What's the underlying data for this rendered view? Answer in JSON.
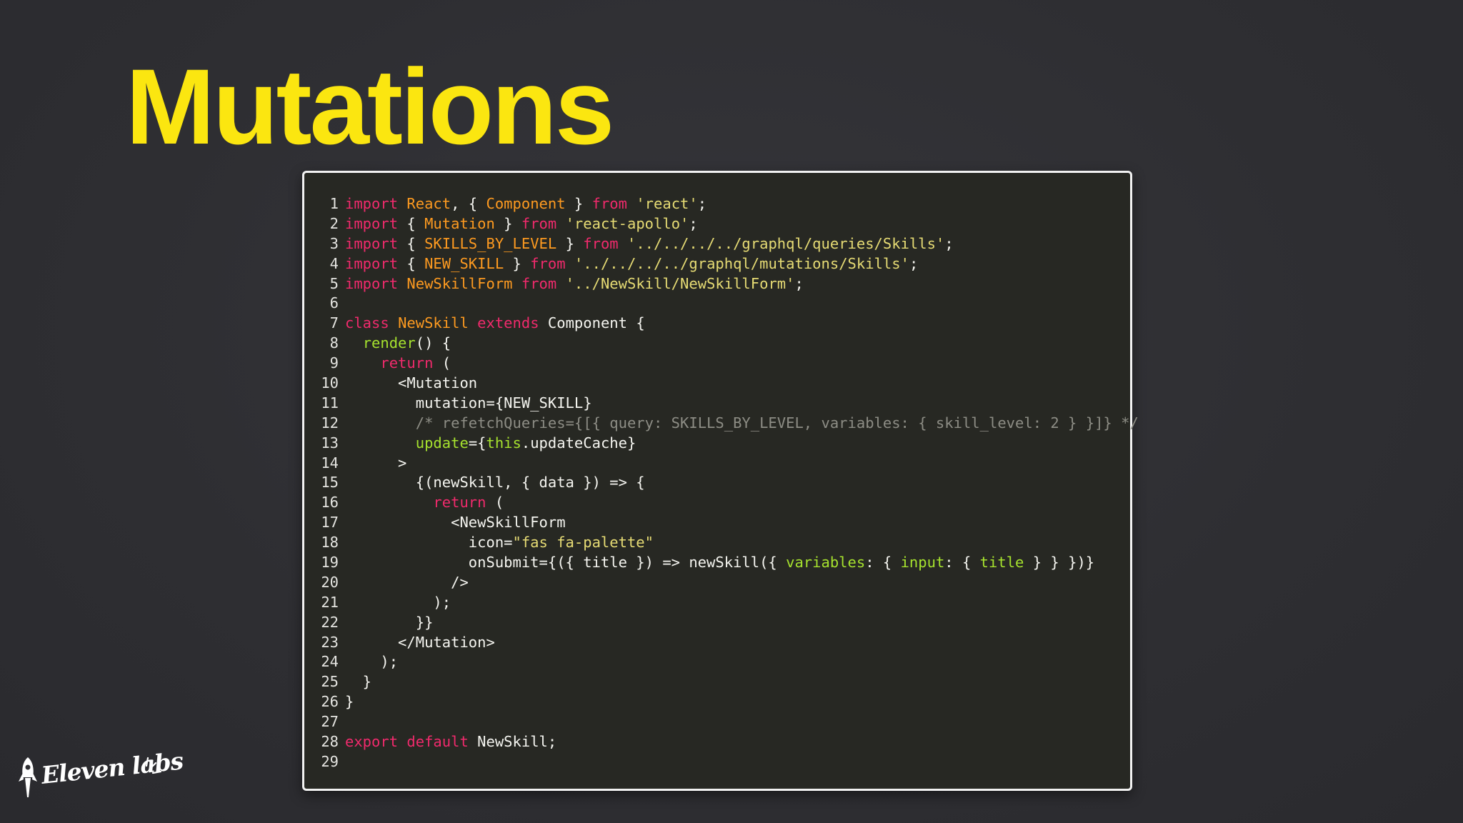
{
  "slide": {
    "title": "Mutations"
  },
  "code": {
    "lines": [
      [
        [
          "kw",
          "import"
        ],
        [
          "txt",
          " "
        ],
        [
          "cls",
          "React"
        ],
        [
          "txt",
          ", { "
        ],
        [
          "cls",
          "Component"
        ],
        [
          "txt",
          " } "
        ],
        [
          "kw",
          "from"
        ],
        [
          "txt",
          " "
        ],
        [
          "str",
          "'react'"
        ],
        [
          "txt",
          ";"
        ]
      ],
      [
        [
          "kw",
          "import"
        ],
        [
          "txt",
          " { "
        ],
        [
          "cls",
          "Mutation"
        ],
        [
          "txt",
          " } "
        ],
        [
          "kw",
          "from"
        ],
        [
          "txt",
          " "
        ],
        [
          "str",
          "'react-apollo'"
        ],
        [
          "txt",
          ";"
        ]
      ],
      [
        [
          "kw",
          "import"
        ],
        [
          "txt",
          " { "
        ],
        [
          "cls",
          "SKILLS_BY_LEVEL"
        ],
        [
          "txt",
          " } "
        ],
        [
          "kw",
          "from"
        ],
        [
          "txt",
          " "
        ],
        [
          "str",
          "'../../../../graphql/queries/Skills'"
        ],
        [
          "txt",
          ";"
        ]
      ],
      [
        [
          "kw",
          "import"
        ],
        [
          "txt",
          " { "
        ],
        [
          "cls",
          "NEW_SKILL"
        ],
        [
          "txt",
          " } "
        ],
        [
          "kw",
          "from"
        ],
        [
          "txt",
          " "
        ],
        [
          "str",
          "'../../../../graphql/mutations/Skills'"
        ],
        [
          "txt",
          ";"
        ]
      ],
      [
        [
          "kw",
          "import"
        ],
        [
          "txt",
          " "
        ],
        [
          "cls",
          "NewSkillForm"
        ],
        [
          "txt",
          " "
        ],
        [
          "kw",
          "from"
        ],
        [
          "txt",
          " "
        ],
        [
          "str",
          "'../NewSkill/NewSkillForm'"
        ],
        [
          "txt",
          ";"
        ]
      ],
      [],
      [
        [
          "kw",
          "class"
        ],
        [
          "txt",
          " "
        ],
        [
          "cls",
          "NewSkill"
        ],
        [
          "txt",
          " "
        ],
        [
          "kw",
          "extends"
        ],
        [
          "txt",
          " Component {"
        ]
      ],
      [
        [
          "txt",
          "  "
        ],
        [
          "fn",
          "render"
        ],
        [
          "txt",
          "() {"
        ]
      ],
      [
        [
          "txt",
          "    "
        ],
        [
          "kw",
          "return"
        ],
        [
          "txt",
          " ("
        ]
      ],
      [
        [
          "txt",
          "      <Mutation"
        ]
      ],
      [
        [
          "txt",
          "        mutation={NEW_SKILL}"
        ]
      ],
      [
        [
          "txt",
          "        "
        ],
        [
          "cmt",
          "/* refetchQueries={[{ query: SKILLS_BY_LEVEL, variables: { skill_level: 2 } }]} */"
        ]
      ],
      [
        [
          "txt",
          "        "
        ],
        [
          "fn",
          "update"
        ],
        [
          "txt",
          "={"
        ],
        [
          "fn",
          "this"
        ],
        [
          "txt",
          ".updateCache}"
        ]
      ],
      [
        [
          "txt",
          "      >"
        ]
      ],
      [
        [
          "txt",
          "        {(newSkill, { data }) => {"
        ]
      ],
      [
        [
          "txt",
          "          "
        ],
        [
          "kw",
          "return"
        ],
        [
          "txt",
          " ("
        ]
      ],
      [
        [
          "txt",
          "            <NewSkillForm"
        ]
      ],
      [
        [
          "txt",
          "              icon="
        ],
        [
          "str",
          "\"fas fa-palette\""
        ]
      ],
      [
        [
          "txt",
          "              onSubmit={({ title }) => newSkill({ "
        ],
        [
          "fn",
          "variables"
        ],
        [
          "txt",
          ": { "
        ],
        [
          "fn",
          "input"
        ],
        [
          "txt",
          ": { "
        ],
        [
          "fn",
          "title"
        ],
        [
          "txt",
          " } } })}"
        ]
      ],
      [
        [
          "txt",
          "            />"
        ]
      ],
      [
        [
          "txt",
          "          );"
        ]
      ],
      [
        [
          "txt",
          "        }}"
        ]
      ],
      [
        [
          "txt",
          "      </Mutation>"
        ]
      ],
      [
        [
          "txt",
          "    );"
        ]
      ],
      [
        [
          "txt",
          "  }"
        ]
      ],
      [
        [
          "txt",
          "}"
        ]
      ],
      [],
      [
        [
          "kw",
          "export"
        ],
        [
          "txt",
          " "
        ],
        [
          "kw",
          "default"
        ],
        [
          "txt",
          " NewSkill;"
        ]
      ],
      []
    ]
  },
  "logo": {
    "text": "Eleven labs"
  }
}
